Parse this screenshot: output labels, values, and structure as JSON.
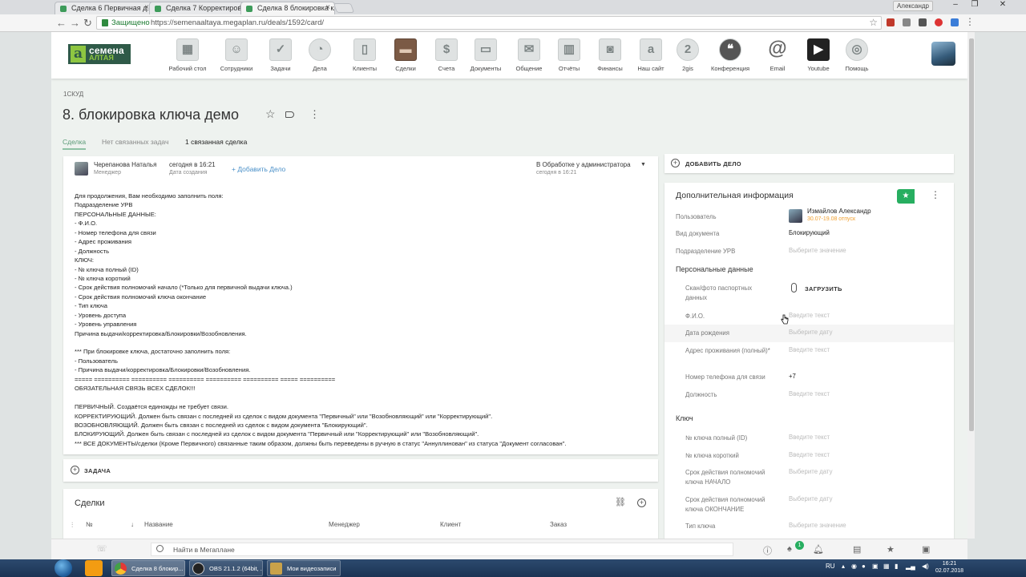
{
  "browser": {
    "tabs": [
      {
        "title": "Сделка 6 Первичная д..."
      },
      {
        "title": "Сделка 7 Корректиров..."
      },
      {
        "title": "Сделка 8 блокировка кл..."
      }
    ],
    "window_user": "Александр",
    "security_label": "Защищено",
    "url": "https://semenaaltaya.megaplan.ru/deals/1592/card/"
  },
  "logo": {
    "mark": "a",
    "line1": "семена",
    "line2": "АЛТАЯ"
  },
  "nav": [
    {
      "label": "Рабочий стол",
      "icon": "desktop-icon",
      "glyph": "▦"
    },
    {
      "label": "Сотрудники",
      "icon": "employees-icon",
      "glyph": "☺"
    },
    {
      "label": "Задачи",
      "icon": "tasks-icon",
      "glyph": "✓"
    },
    {
      "label": "Дела",
      "icon": "clock-icon",
      "glyph": "◔"
    },
    {
      "label": "Клиенты",
      "icon": "clients-icon",
      "glyph": "▯"
    },
    {
      "label": "Сделки",
      "icon": "briefcase-icon",
      "glyph": "▬"
    },
    {
      "label": "Счета",
      "icon": "invoice-icon",
      "glyph": "$"
    },
    {
      "label": "Документы",
      "icon": "documents-icon",
      "glyph": "▭"
    },
    {
      "label": "Общение",
      "icon": "chat-icon",
      "glyph": "✉"
    },
    {
      "label": "Отчёты",
      "icon": "reports-icon",
      "glyph": "▥"
    },
    {
      "label": "Финансы",
      "icon": "safe-icon",
      "glyph": "◙"
    },
    {
      "label": "Наш сайт",
      "icon": "site-icon",
      "glyph": "a"
    },
    {
      "label": "2gis",
      "icon": "2gis-icon",
      "glyph": "2"
    },
    {
      "label": "Конференция",
      "icon": "conference-icon",
      "glyph": "❝"
    },
    {
      "label": "Email",
      "icon": "at-icon",
      "glyph": "@"
    },
    {
      "label": "Youtube",
      "icon": "youtube-icon",
      "glyph": "▶"
    },
    {
      "label": "Помощь",
      "icon": "help-icon",
      "glyph": "◎"
    }
  ],
  "breadcrumb": "1СКУД",
  "title": "8. блокировка ключа демо",
  "subtabs": [
    "Сделка",
    "Нет связанных задач",
    "1 связанная сделка"
  ],
  "deal": {
    "manager_name": "Черепанова Наталья",
    "manager_role": "Менеджер",
    "created_value": "сегодня в 16:21",
    "created_label": "Дата создания",
    "add_case": "+ Добавить Дело",
    "status": "В Обработке у администратора",
    "status_date": "сегодня в 16:21",
    "description": [
      "Для продолжения, Вам необходимо заполнить поля:",
      "Подразделение УРВ",
      "ПЕРСОНАЛЬНЫЕ ДАННЫЕ:",
      "- Ф.И.О.",
      "- Номер телефона для связи",
      "- Адрес проживания",
      "- Должность",
      "КЛЮЧ:",
      "- № ключа полный (ID)",
      "- № ключа короткий",
      "- Срок действия полномочий начало (*Только для первичной выдачи ключа.)",
      "- Срок действия полномочий ключа окончание",
      "- Тип ключа",
      "- Уровень доступа",
      "- Уровень управления",
      "Причина выдачи/корректировка/Блокировки/Возобновления.",
      "",
      "*** При блокировке ключа, достаточно заполнить поля:",
      "- Пользователь",
      "- Причина выдачи/корректировка/Блокировки/Возобновления.",
      "===== ========== ========== ========== ========== ========== ===== ==========",
      "ОБЯЗАТЕЛЬНАЯ СВЯЗЬ ВСЕХ СДЕЛОК!!!",
      "",
      "ПЕРВИЧНЫЙ. Создаётся единожды не требует связи.",
      "КОРРЕКТИРУЮЩИЙ. Должен быть связан с последней из сделок с видом документа \"Первичный\" или \"Возобновляющий\" или \"Корректирующий\".",
      "ВОЗОБНОВЛЯЮЩИЙ. Должен быть связан с последней из сделок с видом документа \"Блокирующий\".",
      "БЛОКИРУЮЩИЙ. Должен быть связан с последней из сделок с видом документа \"Первичный или \"Корректирующий\" или \"Возобновляющий\".",
      "*** ВСЕ ДОКУМЕНТЫ/сделки (Кроме Первичного) связанные таким образом, должны быть переведены в ручную в статус \"Аннуллинован\" из статуса \"Документ согласован\"."
    ]
  },
  "task_button": "ЗАДАЧА",
  "deals_section": {
    "title": "Сделки",
    "columns": [
      "№",
      "Название",
      "Менеджер",
      "Клиент",
      "Заказ"
    ]
  },
  "add_case_button": "ДОБАВИТЬ ДЕЛО",
  "info": {
    "title": "Дополнительная информация",
    "user_label": "Пользователь",
    "user_name": "Измайлов Александр",
    "user_away": "30.07-19.08 отпуск",
    "doc_type_label": "Вид документа",
    "doc_type_value": "Блокирующий",
    "dept_label": "Подразделение УРВ",
    "dept_value": "Выберите значение",
    "personal_section": "Персональные данные",
    "scan_label": "Скан/фото паспортных данных",
    "upload": "ЗАГРУЗИТЬ",
    "fio_label": "Ф.И.О.",
    "fio_value": "Введите текст",
    "dob_label": "Дата рождения",
    "dob_value": "Выберите дату",
    "addr_label": "Адрес проживания (полный)*",
    "addr_value": "Введите текст",
    "phone_label": "Номер телефона для связи",
    "phone_value": "+7",
    "position_label": "Должность",
    "position_value": "Введите текст",
    "key_section": "Ключ",
    "key_full_label": "№ ключа полный (ID)",
    "key_full_value": "Введите текст",
    "key_short_label": "№ ключа короткий",
    "key_short_value": "Введите текст",
    "start_label": "Срок действия полномочий ключа НАЧАЛО",
    "start_value": "Выберите дату",
    "end_label": "Срок действия полномочий ключа ОКОНЧАНИЕ",
    "end_value": "Выберите дату",
    "keytype_label": "Тип ключа",
    "keytype_value": "Выберите значение"
  },
  "bottom": {
    "search_placeholder": "Найти в Мегаплане",
    "notif_count": "1"
  },
  "taskbar": {
    "items": [
      "Сделка 8 блокир...",
      "OBS 21.1.2 (64bit, ...",
      "Мои видеозаписи"
    ],
    "lang": "RU",
    "time": "16:21",
    "date": "02.07.2018"
  },
  "colors": {
    "brand": "#2f5a48",
    "accent": "#8ec641",
    "link": "#4a90c8",
    "badge": "#27ae60"
  }
}
